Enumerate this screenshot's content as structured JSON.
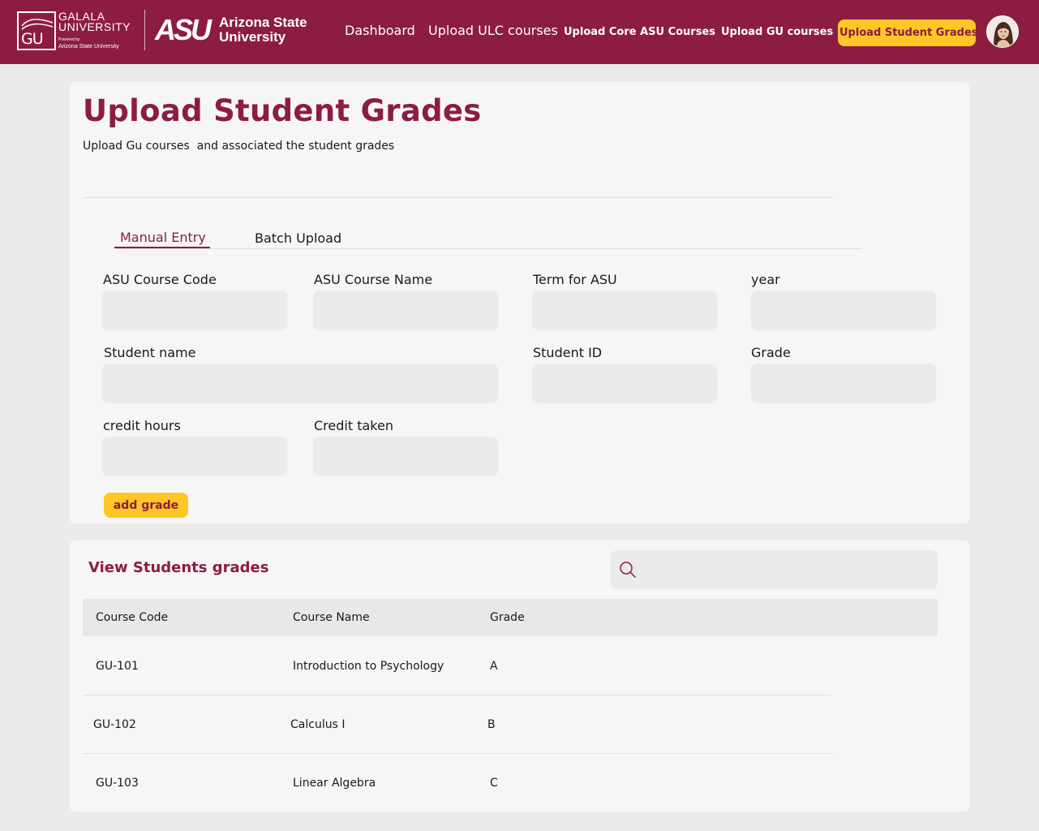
{
  "brand": {
    "gu_name_line1": "GALALA",
    "gu_name_line2": "UNIVERSITY",
    "gu_letters": "GU",
    "gu_powered": "Powered by",
    "gu_powered_asu": "Arizona State University",
    "asu_mark": "ASU",
    "asu_name_line1": "Arizona State",
    "asu_name_line2": "University"
  },
  "nav": {
    "dashboard": "Dashboard",
    "upload_ulc": "Upload ULC courses",
    "upload_core": "Upload Core ASU Courses",
    "upload_gu": "Upload GU courses",
    "upload_grades": "Upload Student Grades"
  },
  "colors": {
    "maroon": "#8c1d40",
    "gold": "#ffc627",
    "page_bg": "#ebebeb",
    "card_bg": "#f7f6f7"
  },
  "page": {
    "title": "Upload Student Grades",
    "subtitle": "Upload Gu courses  and associated the student grades"
  },
  "tabs": {
    "manual": "Manual Entry",
    "batch": "Batch Upload",
    "active": "Manual Entry"
  },
  "form": {
    "course_code_label": "ASU Course Code",
    "course_name_label": "ASU Course Name",
    "term_label": "Term for ASU",
    "year_label": "year",
    "student_name_label": "Student name",
    "student_id_label": "Student ID",
    "grade_label": "Grade",
    "credit_hours_label": "credit hours",
    "credit_taken_label": "Credit taken",
    "add_button": "add grade"
  },
  "grades": {
    "title": "View Students grades",
    "search_icon": "search-icon",
    "columns": [
      "Course Code",
      "Course Name",
      "Grade"
    ],
    "rows": [
      {
        "code": "GU-101",
        "name": "Introduction to Psychology",
        "grade": "A"
      },
      {
        "code": "GU-102",
        "name": "Calculus I",
        "grade": "B"
      },
      {
        "code": "GU-103",
        "name": "Linear Algebra",
        "grade": "C"
      }
    ]
  }
}
